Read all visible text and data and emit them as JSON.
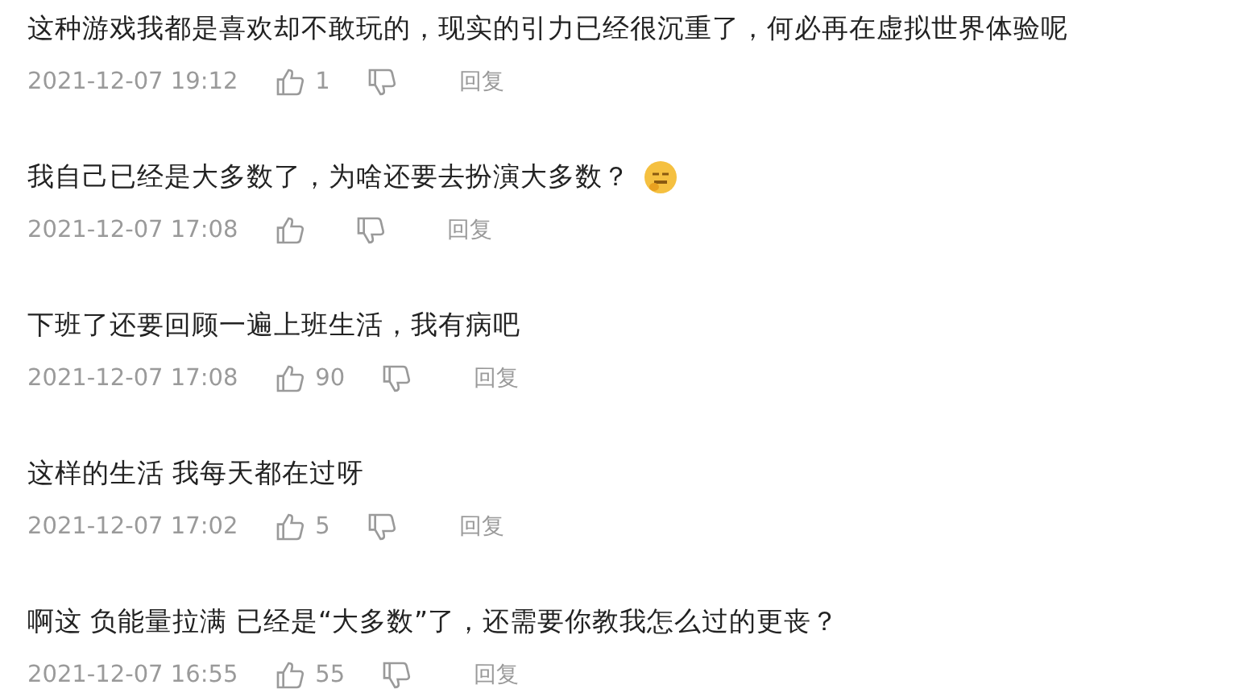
{
  "comments": [
    {
      "text": "这种游戏我都是喜欢却不敢玩的，现实的引力已经很沉重了，何必再在虚拟世界体验呢",
      "time": "2021-12-07 19:12",
      "likes": "1",
      "reply": "回复",
      "emoji": false
    },
    {
      "text": "我自己已经是大多数了，为啥还要去扮演大多数？",
      "time": "2021-12-07 17:08",
      "reply": "回复",
      "emoji": true
    },
    {
      "text": "下班了还要回顾一遍上班生活，我有病吧",
      "time": "2021-12-07 17:08",
      "likes": "90",
      "reply": "回复",
      "emoji": false
    },
    {
      "text": "这样的生活 我每天都在过呀",
      "time": "2021-12-07 17:02",
      "likes": "5",
      "reply": "回复",
      "emoji": false
    },
    {
      "text": "啊这 负能量拉满 已经是“大多数”了，还需要你教我怎么过的更丧？",
      "time": "2021-12-07 16:55",
      "likes": "55",
      "reply": "回复",
      "emoji": false
    }
  ]
}
